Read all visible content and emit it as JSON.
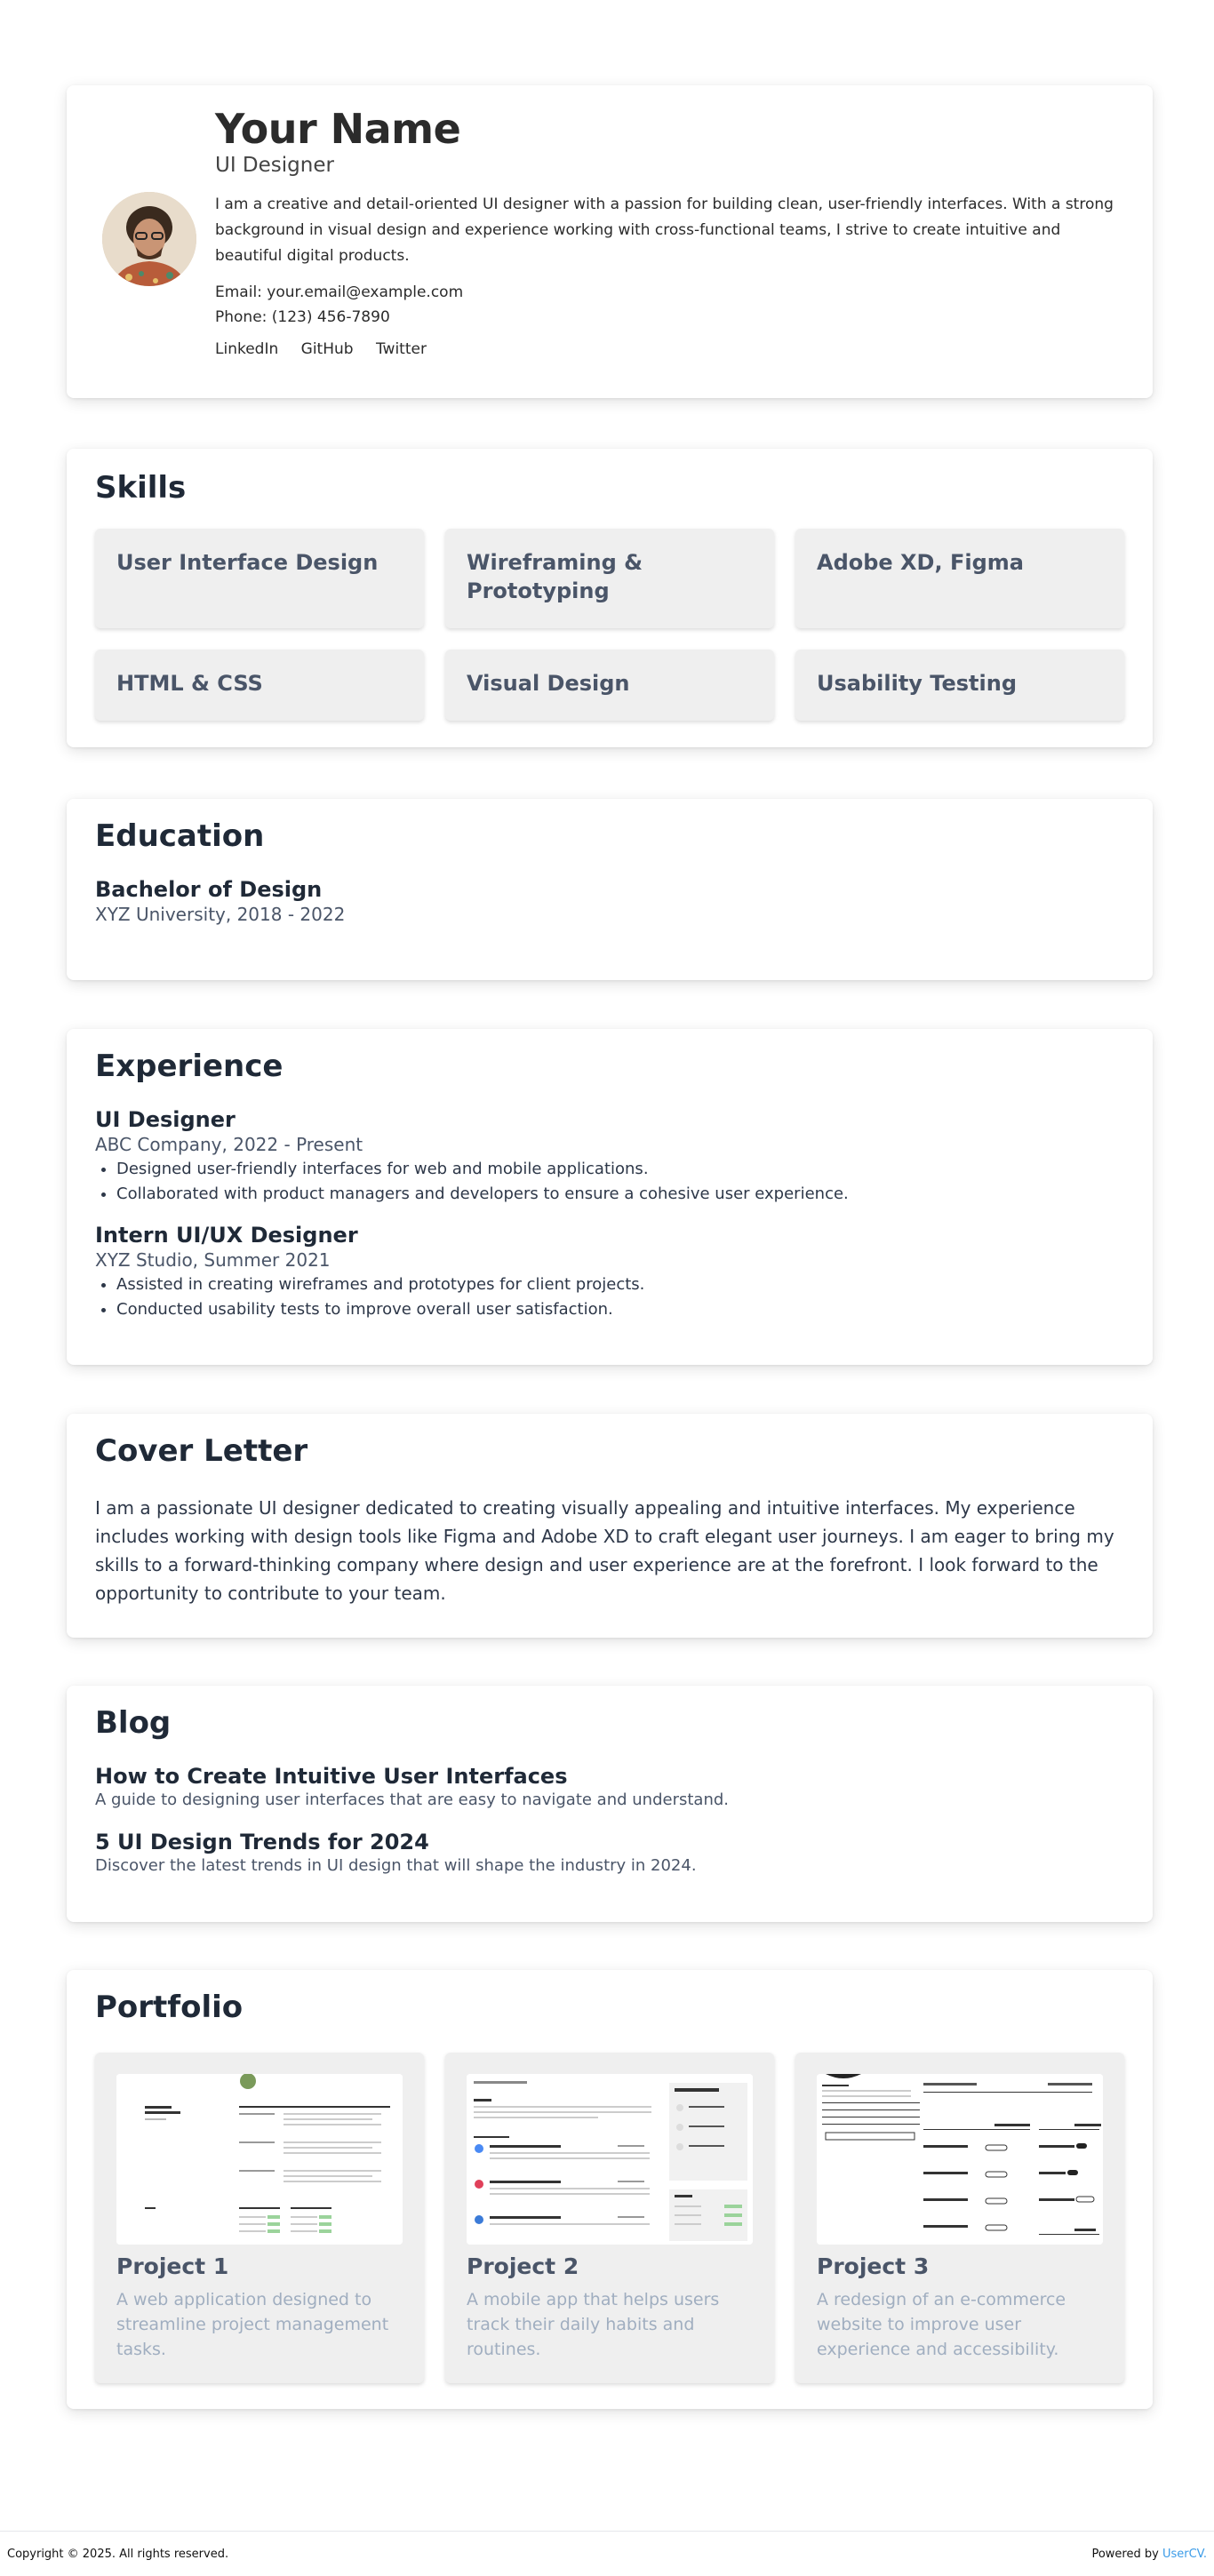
{
  "profile": {
    "name": "Your Name",
    "role": "UI Designer",
    "about": "I am a creative and detail-oriented UI designer with a passion for building clean, user-friendly interfaces. With a strong background in visual design and experience working with cross-functional teams, I strive to create intuitive and beautiful digital products.",
    "email": "Email: your.email@example.com",
    "phone": "Phone: (123) 456-7890",
    "links": [
      "LinkedIn",
      "GitHub",
      "Twitter"
    ]
  },
  "skills": {
    "title": "Skills",
    "items": [
      "User Interface Design",
      "Wireframing & Prototyping",
      "Adobe XD, Figma",
      "HTML & CSS",
      "Visual Design",
      "Usability Testing"
    ]
  },
  "education": {
    "title": "Education",
    "degree": "Bachelor of Design",
    "school": "XYZ University, 2018 - 2022"
  },
  "experience": {
    "title": "Experience",
    "jobs": [
      {
        "role": "UI Designer",
        "company": "ABC Company, 2022 - Present",
        "points": [
          "Designed user-friendly interfaces for web and mobile applications.",
          "Collaborated with product managers and developers to ensure a cohesive user experience."
        ]
      },
      {
        "role": "Intern UI/UX Designer",
        "company": "XYZ Studio, Summer 2021",
        "points": [
          "Assisted in creating wireframes and prototypes for client projects.",
          "Conducted usability tests to improve overall user satisfaction."
        ]
      }
    ]
  },
  "cover": {
    "title": "Cover Letter",
    "text": "I am a passionate UI designer dedicated to creating visually appealing and intuitive interfaces. My experience includes working with design tools like Figma and Adobe XD to craft elegant user journeys. I am eager to bring my skills to a forward-thinking company where design and user experience are at the forefront. I look forward to the opportunity to contribute to your team."
  },
  "blog": {
    "title": "Blog",
    "posts": [
      {
        "title": "How to Create Intuitive User Interfaces",
        "desc": "A guide to designing user interfaces that are easy to navigate and understand."
      },
      {
        "title": "5 UI Design Trends for 2024",
        "desc": "Discover the latest trends in UI design that will shape the industry in 2024."
      }
    ]
  },
  "portfolio": {
    "title": "Portfolio",
    "projects": [
      {
        "title": "Project 1",
        "desc": "A web application designed to streamline project management tasks."
      },
      {
        "title": "Project 2",
        "desc": "A mobile app that helps users track their daily habits and routines."
      },
      {
        "title": "Project 3",
        "desc": "A redesign of an e-commerce website to improve user experience and accessibility."
      }
    ]
  },
  "footer": {
    "copyright": "Copyright © 2025. All rights reserved.",
    "powered_prefix": "Powered by ",
    "powered_link": "UserCV."
  },
  "colors": {
    "accent_link": "#3b9be8",
    "heading": "#1f2937",
    "card_bg": "#efefef",
    "muted": "#a0aec0"
  }
}
